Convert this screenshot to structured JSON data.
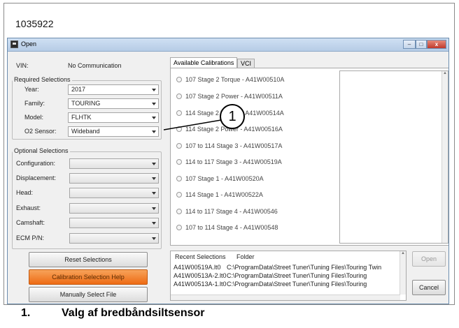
{
  "figure_id": "1035922",
  "window": {
    "title": "Open",
    "controls": {
      "minimize": "–",
      "maximize": "□",
      "close": "x"
    }
  },
  "vin": {
    "label": "VIN:",
    "value": "No Communication"
  },
  "required": {
    "title": "Required Selections",
    "fields": [
      {
        "label": "Year:",
        "value": "2017"
      },
      {
        "label": "Family:",
        "value": "TOURING"
      },
      {
        "label": "Model:",
        "value": "FLHTK"
      },
      {
        "label": "O2 Sensor:",
        "value": "Wideband"
      }
    ]
  },
  "optional": {
    "title": "Optional Selections",
    "fields": [
      {
        "label": "Configuration:",
        "value": ""
      },
      {
        "label": "Displacement:",
        "value": ""
      },
      {
        "label": "Head:",
        "value": ""
      },
      {
        "label": "Exhaust:",
        "value": ""
      },
      {
        "label": "Camshaft:",
        "value": ""
      },
      {
        "label": "ECM P/N:",
        "value": ""
      }
    ]
  },
  "buttons": {
    "reset": "Reset Selections",
    "help": "Calibration Selection Help",
    "manual": "Manually Select File",
    "open": "Open",
    "cancel": "Cancel"
  },
  "tabs": [
    "Available Calibrations",
    "VCI"
  ],
  "calibrations": [
    "107 Stage 2 Torque - A41W00510A",
    "107 Stage 2 Power - A41W00511A",
    "114 Stage 2 Torque - A41W00514A",
    "114 Stage 2 Power - A41W00516A",
    "107 to 114 Stage 3 - A41W00517A",
    "114 to 117 Stage 3 - A41W00519A",
    "107 Stage 1 - A41W00520A",
    "114 Stage 1 - A41W00522A",
    "114 to 117 Stage 4 - A41W00546",
    "107 to 114 Stage 4 - A41W00548"
  ],
  "recent": {
    "headers": [
      "Recent Selections",
      "Folder"
    ],
    "rows": [
      {
        "file": "A41W00519A.lt0",
        "folder": "C:\\ProgramData\\Street Tuner\\Tuning Files\\Touring Twin"
      },
      {
        "file": "A41W00513A-2.lt0",
        "folder": "C:\\ProgramData\\Street Tuner\\Tuning Files\\Touring"
      },
      {
        "file": "A41W00513A-1.lt0",
        "folder": "C:\\ProgramData\\Street Tuner\\Tuning Files\\Touring"
      }
    ]
  },
  "callout": {
    "number": "1"
  },
  "caption": {
    "number": "1.",
    "text": "Valg af bredbåndsiltsensor"
  },
  "colors": {
    "help_button": "#ee6b14",
    "titlebar": "#c2d6ee",
    "close_button": "#c0392b"
  }
}
